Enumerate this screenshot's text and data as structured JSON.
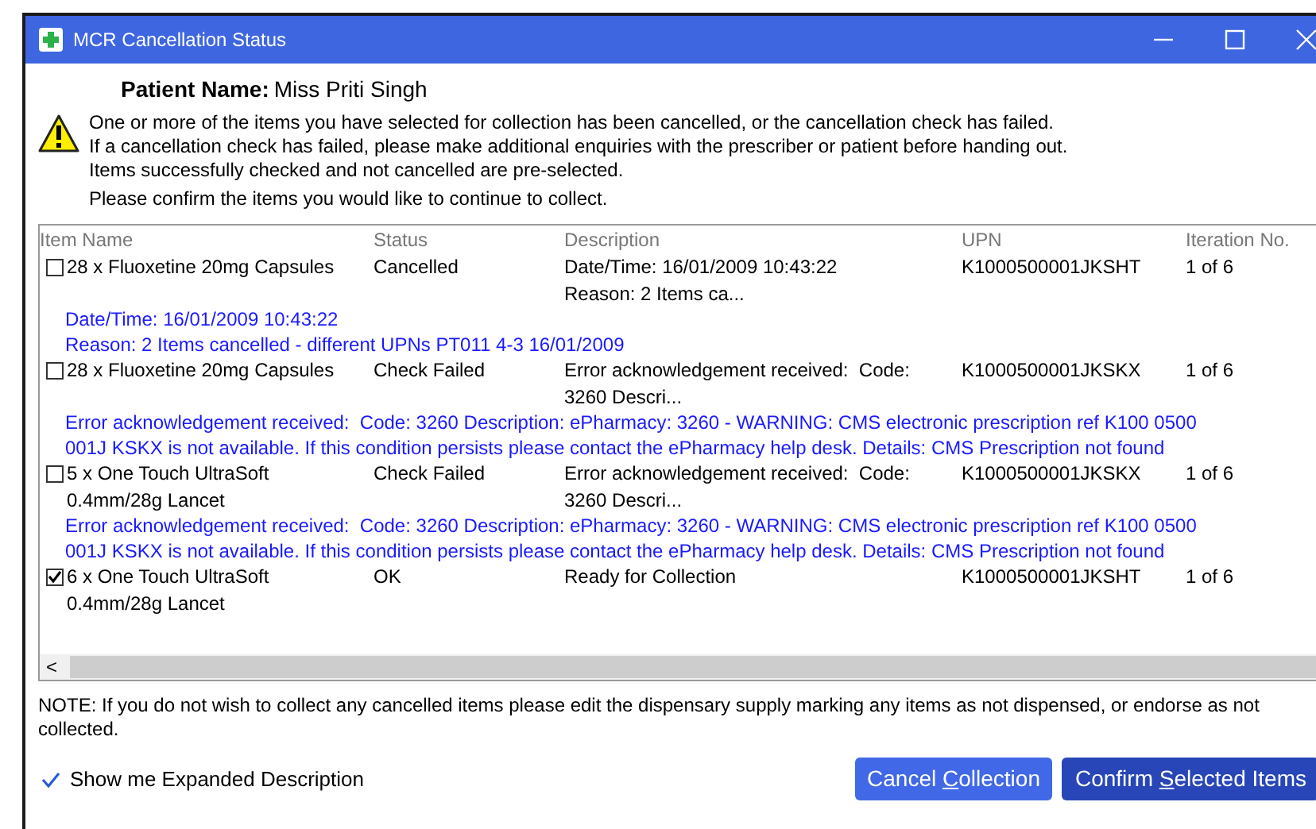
{
  "window": {
    "title": "MCR Cancellation Status"
  },
  "patient": {
    "label": "Patient Name:",
    "value": "Miss Priti Singh"
  },
  "message_lines": [
    "One or more of the items you have selected for collection has been cancelled, or the cancellation check has failed.",
    "If a cancellation check has failed, please make additional enquiries with the prescriber or patient before handing out.",
    "Items successfully checked and not cancelled are pre-selected."
  ],
  "prompt": "Please confirm the items you would like to continue to collect.",
  "table": {
    "columns": [
      "Item Name",
      "Status",
      "Description",
      "UPN",
      "Iteration No."
    ],
    "rows": [
      {
        "checked": false,
        "item_lines": [
          "28 x Fluoxetine 20mg Capsules"
        ],
        "status": "Cancelled",
        "description_lines": [
          "Date/Time: 16/01/2009 10:43:22",
          "Reason: 2 Items ca..."
        ],
        "upn": "K1000500001JKSHT",
        "iteration": "1 of 6",
        "expanded_lines": [
          "Date/Time: 16/01/2009 10:43:22",
          "Reason: 2 Items cancelled - different UPNs PT011 4-3 16/01/2009"
        ]
      },
      {
        "checked": false,
        "item_lines": [
          "28 x Fluoxetine 20mg Capsules"
        ],
        "status": "Check Failed",
        "description_lines": [
          "Error acknowledgement received:  Code:",
          "3260 Descri..."
        ],
        "upn": "K1000500001JKSKX",
        "iteration": "1 of 6",
        "expanded_lines": [
          "Error acknowledgement received:  Code: 3260 Description: ePharmacy: 3260 - WARNING: CMS electronic prescription ref K100 0500",
          "001J KSKX is not available. If this condition persists please contact the ePharmacy help desk. Details: CMS Prescription not found"
        ]
      },
      {
        "checked": false,
        "item_lines": [
          "5 x One Touch UltraSoft",
          "0.4mm/28g Lancet"
        ],
        "status": "Check Failed",
        "description_lines": [
          "Error acknowledgement received:  Code:",
          "3260 Descri..."
        ],
        "upn": "K1000500001JKSKX",
        "iteration": "1 of 6",
        "expanded_lines": [
          "Error acknowledgement received:  Code: 3260 Description: ePharmacy: 3260 - WARNING: CMS electronic prescription ref K100 0500",
          "001J KSKX is not available. If this condition persists please contact the ePharmacy help desk. Details: CMS Prescription not found"
        ]
      },
      {
        "checked": true,
        "item_lines": [
          "6 x One Touch UltraSoft",
          "0.4mm/28g Lancet"
        ],
        "status": "OK",
        "description_lines": [
          "Ready for Collection"
        ],
        "upn": "K1000500001JKSHT",
        "iteration": "1 of 6"
      }
    ]
  },
  "scroll_arrow": "<",
  "note": "NOTE: If you do not wish to collect any cancelled items please edit the dispensary supply marking any items as not dispensed, or endorse as not collected.",
  "expanded_option": {
    "label": "Show me Expanded Description",
    "checked": true
  },
  "buttons": [
    {
      "kind": "secondary",
      "before": "Cancel ",
      "key": "C",
      "after": "ollection"
    },
    {
      "kind": "primary",
      "before": "Confirm ",
      "key": "S",
      "after": "elected Items"
    }
  ]
}
